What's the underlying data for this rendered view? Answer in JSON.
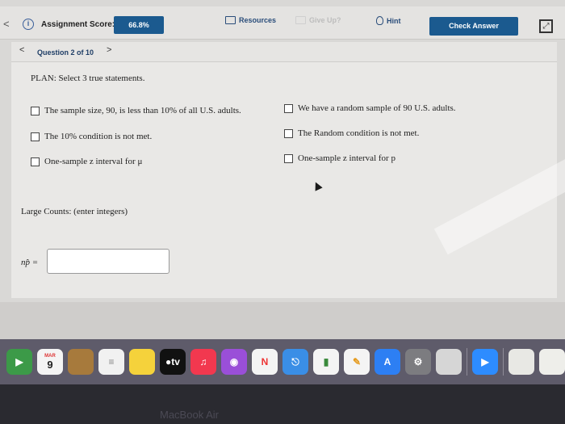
{
  "header": {
    "back_chevron": "<",
    "score_label": "Assignment Score:",
    "score_value": "66.8%",
    "resources_label": "Resources",
    "give_up_label": "Give Up?",
    "hint_label": "Hint",
    "check_answer_label": "Check Answer"
  },
  "question_nav": {
    "prev": "<",
    "label": "Question 2 of 10",
    "next": ">"
  },
  "question": {
    "plan_text": "PLAN: Select 3 true statements.",
    "options": [
      {
        "label": "The sample size, 90, is less than 10% of all U.S. adults.",
        "checked": false
      },
      {
        "label": "We have a random sample of 90 U.S. adults.",
        "checked": false
      },
      {
        "label": "The 10% condition is not met.",
        "checked": false
      },
      {
        "label": "The Random condition is not met.",
        "checked": false
      },
      {
        "label": "One-sample z interval for μ",
        "checked": false
      },
      {
        "label": "One-sample z interval for p",
        "checked": false
      }
    ],
    "large_counts_label": "Large Counts: (enter integers)",
    "np_label": "np̂ =",
    "np_value": ""
  },
  "dock": {
    "calendar_month": "MAR",
    "calendar_day": "9",
    "tv_label": "●tv"
  },
  "device_label": "MacBook Air",
  "colors": {
    "accent": "#1b5a8f",
    "page_bg": "#e9e8e6",
    "dock_bg": "#5e5b6a"
  }
}
